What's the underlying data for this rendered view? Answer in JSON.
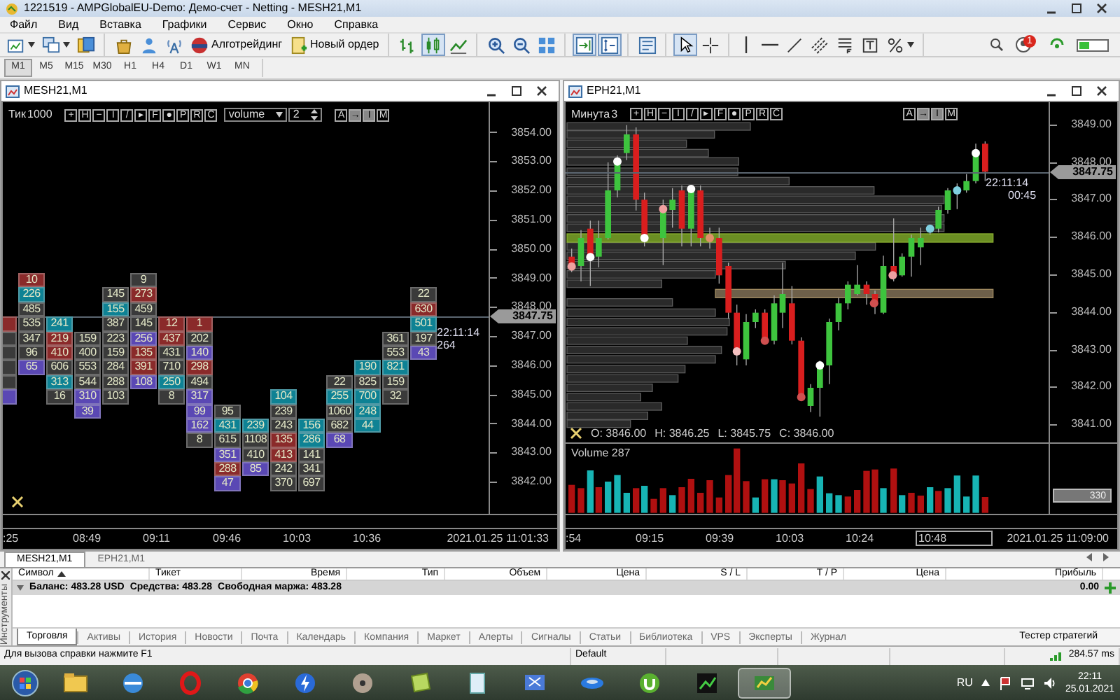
{
  "window": {
    "title": "1221519 - AMPGlobalEU-Demo: Демо-счет - Netting - MESH21,M1"
  },
  "menu": [
    "Файл",
    "Вид",
    "Вставка",
    "Графики",
    "Сервис",
    "Окно",
    "Справка"
  ],
  "toolbar": [
    [
      {
        "kind": "new-chart",
        "pressed": false,
        "menu": true
      },
      {
        "kind": "profiles",
        "pressed": false,
        "menu": true
      },
      {
        "kind": "windows",
        "pressed": false,
        "menu": false
      }
    ],
    [
      {
        "kind": "market",
        "pressed": false,
        "menu": false
      },
      {
        "kind": "navigator",
        "pressed": false,
        "menu": false
      },
      {
        "kind": "signal",
        "pressed": false,
        "menu": false
      },
      {
        "kind": "algo",
        "label": "Алготрейдинг",
        "pressed": false,
        "menu": false
      },
      {
        "kind": "order",
        "label": "Новый ордер",
        "pressed": false,
        "menu": false
      }
    ],
    [
      {
        "kind": "bars",
        "pressed": false,
        "menu": false
      },
      {
        "kind": "candles",
        "pressed": true,
        "menu": false
      },
      {
        "kind": "line",
        "pressed": false,
        "menu": false
      }
    ],
    [
      {
        "kind": "zoom-in",
        "pressed": false,
        "menu": false
      },
      {
        "kind": "zoom-out",
        "pressed": false,
        "menu": false
      },
      {
        "kind": "tile",
        "pressed": false,
        "menu": false
      }
    ],
    [
      {
        "kind": "shift",
        "pressed": true,
        "menu": false
      },
      {
        "kind": "autoscroll",
        "pressed": true,
        "menu": false
      }
    ],
    [
      {
        "kind": "template",
        "pressed": false,
        "menu": false
      }
    ],
    [
      {
        "kind": "cursor",
        "pressed": true,
        "menu": false
      },
      {
        "kind": "crosshair",
        "pressed": false,
        "menu": false
      }
    ],
    [
      {
        "kind": "vline",
        "pressed": false,
        "menu": false
      },
      {
        "kind": "hline",
        "pressed": false,
        "menu": false
      },
      {
        "kind": "trend",
        "pressed": false,
        "menu": false
      },
      {
        "kind": "channel",
        "pressed": false,
        "menu": false
      },
      {
        "kind": "levels",
        "pressed": false,
        "menu": false
      },
      {
        "kind": "textbox",
        "pressed": false,
        "menu": false
      },
      {
        "kind": "shapes",
        "pressed": false,
        "menu": true
      }
    ]
  ],
  "status_icons": {
    "notifications": "1"
  },
  "timeframes": [
    {
      "label": "M1",
      "selected": true
    },
    {
      "label": "M5",
      "selected": false
    },
    {
      "label": "M15",
      "selected": false
    },
    {
      "label": "M30",
      "selected": false
    },
    {
      "label": "H1",
      "selected": false
    },
    {
      "label": "H4",
      "selected": false
    },
    {
      "label": "D1",
      "selected": false
    },
    {
      "label": "W1",
      "selected": false
    },
    {
      "label": "MN",
      "selected": false
    }
  ],
  "charts": [
    {
      "title": "MESH21,M1",
      "kind": "footprint",
      "mode": "Тик",
      "period": "1000",
      "buttons": [
        "+",
        "H",
        "−",
        "I",
        "/",
        "▸",
        "F",
        "●",
        "P",
        "R",
        "C"
      ],
      "select": "volume",
      "spin": "2",
      "right_buttons": [
        {
          "label": "A",
          "pressed": false
        },
        {
          "label": "→",
          "pressed": true
        },
        {
          "label": "I",
          "pressed": true
        },
        {
          "label": "M",
          "pressed": false
        }
      ],
      "axis": [
        "3854.00",
        "3853.00",
        "3852.00",
        "3851.00",
        "3850.00",
        "3849.00",
        "3848.00",
        "3847.00",
        "3846.00",
        "3845.00",
        "3844.00",
        "3843.00",
        "3842.00"
      ],
      "price": "3847.75",
      "timer": "22:11:14",
      "timer_2": "264",
      "clusters": [
        {
          "cells": [
            null,
            null,
            null,
            {
              "color": "#8a2a2a"
            },
            {
              "color": "#3a3a3a"
            },
            {
              "color": "#3a3a3a"
            },
            {
              "color": "#3a3a3a"
            },
            {
              "color": "#3a3a3a"
            },
            {
              "color": "#5a48b4"
            }
          ]
        },
        {
          "cells": [
            {
              "value": "10",
              "color": "#8a2a2a"
            },
            {
              "value": "226",
              "color": "#0e8294"
            },
            {
              "value": "485",
              "color": "#3a3a3a"
            },
            {
              "value": "535",
              "color": "#3a3a3a"
            },
            {
              "value": "347",
              "color": "#3a3a3a"
            },
            {
              "value": "96",
              "color": "#3a3a3a"
            },
            {
              "value": "65",
              "color": "#5a48b4"
            }
          ]
        },
        {
          "cells": [
            null,
            null,
            null,
            {
              "value": "241",
              "color": "#0e8294"
            },
            {
              "value": "219",
              "color": "#8a2a2a"
            },
            {
              "value": "410",
              "color": "#8a2a2a"
            },
            {
              "value": "606",
              "color": "#3a3a3a"
            },
            {
              "value": "313",
              "color": "#0e8294"
            },
            {
              "value": "16",
              "color": "#3a3a3a"
            }
          ]
        },
        {
          "cells": [
            null,
            null,
            null,
            null,
            {
              "value": "159",
              "color": "#3a3a3a"
            },
            {
              "value": "400",
              "color": "#3a3a3a"
            },
            {
              "value": "553",
              "color": "#3a3a3a"
            },
            {
              "value": "544",
              "color": "#3a3a3a"
            },
            {
              "value": "310",
              "color": "#5a48b4"
            },
            {
              "value": "39",
              "color": "#5a48b4"
            }
          ]
        },
        {
          "cells": [
            null,
            {
              "value": "145",
              "color": "#3a3a3a"
            },
            {
              "value": "155",
              "color": "#0e8294"
            },
            {
              "value": "387",
              "color": "#3a3a3a"
            },
            {
              "value": "223",
              "color": "#3a3a3a"
            },
            {
              "value": "159",
              "color": "#3a3a3a"
            },
            {
              "value": "284",
              "color": "#3a3a3a"
            },
            {
              "value": "288",
              "color": "#3a3a3a"
            },
            {
              "value": "103",
              "color": "#3a3a3a"
            }
          ]
        },
        {
          "cells": [
            {
              "value": "9",
              "color": "#3a3a3a"
            },
            {
              "value": "273",
              "color": "#8a2a2a"
            },
            {
              "value": "459",
              "color": "#3a3a3a"
            },
            {
              "value": "145",
              "color": "#3a3a3a"
            },
            {
              "value": "256",
              "color": "#5a48b4"
            },
            {
              "value": "135",
              "color": "#8a2a2a"
            },
            {
              "value": "391",
              "color": "#8a2a2a"
            },
            {
              "value": "108",
              "color": "#5a48b4"
            }
          ]
        },
        {
          "cells": [
            null,
            null,
            null,
            {
              "value": "12",
              "color": "#8a2a2a"
            },
            {
              "value": "437",
              "color": "#8a2a2a"
            },
            {
              "value": "431",
              "color": "#3a3a3a"
            },
            {
              "value": "710",
              "color": "#3a3a3a"
            },
            {
              "value": "250",
              "color": "#0e8294"
            },
            {
              "value": "8",
              "color": "#3a3a3a"
            }
          ]
        },
        {
          "cells": [
            null,
            null,
            null,
            {
              "value": "1",
              "color": "#8a2a2a"
            },
            {
              "value": "202",
              "color": "#3a3a3a"
            },
            {
              "value": "140",
              "color": "#5a48b4"
            },
            {
              "value": "298",
              "color": "#8a2a2a"
            },
            {
              "value": "494",
              "color": "#3a3a3a"
            },
            {
              "value": "317",
              "color": "#5a48b4"
            },
            {
              "value": "99",
              "color": "#5a48b4"
            },
            {
              "value": "162",
              "color": "#5a48b4"
            },
            {
              "value": "8",
              "color": "#3a3a3a"
            }
          ]
        },
        {
          "cells": [
            null,
            null,
            null,
            null,
            null,
            null,
            null,
            null,
            null,
            {
              "value": "95",
              "color": "#3a3a3a"
            },
            {
              "value": "431",
              "color": "#0e8294"
            },
            {
              "value": "615",
              "color": "#3a3a3a"
            },
            {
              "value": "351",
              "color": "#5a48b4"
            },
            {
              "value": "288",
              "color": "#8a2a2a"
            },
            {
              "value": "47",
              "color": "#5a48b4"
            }
          ]
        },
        {
          "cells": [
            null,
            null,
            null,
            null,
            null,
            null,
            null,
            null,
            null,
            null,
            {
              "value": "239",
              "color": "#0e8294"
            },
            {
              "value": "1108",
              "color": "#3a3a3a"
            },
            {
              "value": "410",
              "color": "#3a3a3a"
            },
            {
              "value": "85",
              "color": "#5a48b4"
            }
          ]
        },
        {
          "cells": [
            null,
            null,
            null,
            null,
            null,
            null,
            null,
            null,
            {
              "value": "104",
              "color": "#0e8294"
            },
            {
              "value": "239",
              "color": "#3a3a3a"
            },
            {
              "value": "243",
              "color": "#3a3a3a"
            },
            {
              "value": "135",
              "color": "#8a2a2a"
            },
            {
              "value": "413",
              "color": "#8a2a2a"
            },
            {
              "value": "242",
              "color": "#3a3a3a"
            },
            {
              "value": "370",
              "color": "#3a3a3a"
            }
          ]
        },
        {
          "cells": [
            null,
            null,
            null,
            null,
            null,
            null,
            null,
            null,
            null,
            null,
            {
              "value": "156",
              "color": "#0e8294"
            },
            {
              "value": "286",
              "color": "#0e8294"
            },
            {
              "value": "141",
              "color": "#3a3a3a"
            },
            {
              "value": "341",
              "color": "#3a3a3a"
            },
            {
              "value": "697",
              "color": "#3a3a3a"
            }
          ]
        },
        {
          "cells": [
            null,
            null,
            null,
            null,
            null,
            null,
            null,
            {
              "value": "22",
              "color": "#3a3a3a"
            },
            {
              "value": "255",
              "color": "#0e8294"
            },
            {
              "value": "1060",
              "color": "#3a3a3a"
            },
            {
              "value": "682",
              "color": "#3a3a3a"
            },
            {
              "value": "68",
              "color": "#5a48b4"
            }
          ]
        },
        {
          "cells": [
            null,
            null,
            null,
            null,
            null,
            null,
            {
              "value": "190",
              "color": "#0e8294"
            },
            {
              "value": "825",
              "color": "#3a3a3a"
            },
            {
              "value": "700",
              "color": "#0e8294"
            },
            {
              "value": "248",
              "color": "#0e8294"
            },
            {
              "value": "44",
              "color": "#0e8294"
            }
          ]
        },
        {
          "cells": [
            null,
            null,
            null,
            null,
            {
              "value": "361",
              "color": "#3a3a3a"
            },
            {
              "value": "553",
              "color": "#3a3a3a"
            },
            {
              "value": "821",
              "color": "#0e8294"
            },
            {
              "value": "159",
              "color": "#3a3a3a"
            },
            {
              "value": "32",
              "color": "#3a3a3a"
            }
          ]
        },
        {
          "cells": [
            null,
            {
              "value": "22",
              "color": "#3a3a3a"
            },
            {
              "value": "630",
              "color": "#8a2a2a"
            },
            {
              "value": "501",
              "color": "#0e8294"
            },
            {
              "value": "197",
              "color": "#3a3a3a"
            },
            {
              "value": "43",
              "color": "#5a48b4"
            }
          ]
        }
      ],
      "times": [
        {
          "label": ":25",
          "boxed": false
        },
        {
          "label": "08:49",
          "boxed": false
        },
        {
          "label": "09:11",
          "boxed": false
        },
        {
          "label": "09:46",
          "boxed": false
        },
        {
          "label": "10:03",
          "boxed": false
        },
        {
          "label": "10:36",
          "boxed": false
        }
      ],
      "datetime": "2021.01.25 11:01:33"
    },
    {
      "title": "EPH21,M1",
      "kind": "candles",
      "mode": "Минута",
      "period": "3",
      "buttons": [
        "+",
        "H",
        "−",
        "I",
        "/",
        "▸",
        "F",
        "●",
        "P",
        "R",
        "C"
      ],
      "right_buttons": [
        {
          "label": "A",
          "pressed": false
        },
        {
          "label": "→",
          "pressed": true
        },
        {
          "label": "I",
          "pressed": true
        },
        {
          "label": "M",
          "pressed": false
        }
      ],
      "axis": [
        "3849.00",
        "3848.00",
        "3847.00",
        "3846.00",
        "3845.00",
        "3844.00",
        "3843.00",
        "3842.00",
        "3841.00"
      ],
      "price": "3847.75",
      "timer": "22:11:14",
      "timer_2": "00:45",
      "ohlc": [
        "O: 3846.00",
        "H: 3846.25",
        "L: 3845.75",
        "C: 3846.00"
      ],
      "volume_label": "Volume 287",
      "volume_axis": "330",
      "times": [
        {
          "label": ":54",
          "boxed": false
        },
        {
          "label": "09:15",
          "boxed": false
        },
        {
          "label": "09:39",
          "boxed": false
        },
        {
          "label": "10:03",
          "boxed": false
        },
        {
          "label": "10:24",
          "boxed": false
        },
        {
          "label": "10:48",
          "boxed": true
        }
      ],
      "datetime": "2021.01.25 11:09:00"
    }
  ],
  "chart_tabs": [
    {
      "label": "MESH21,M1",
      "selected": true
    },
    {
      "label": "EPH21,M1",
      "selected": false
    }
  ],
  "toolbox": {
    "side_label": "Инструменты",
    "columns": [
      {
        "label": "Символ",
        "sorted": true
      },
      {
        "label": "Тикет",
        "sorted": false
      },
      {
        "label": "Время",
        "sorted": false
      },
      {
        "label": "Тип",
        "sorted": false
      },
      {
        "label": "Объем",
        "sorted": false
      },
      {
        "label": "Цена",
        "sorted": false
      },
      {
        "label": "S / L",
        "sorted": false
      },
      {
        "label": "T / P",
        "sorted": false
      },
      {
        "label": "Цена",
        "sorted": false
      },
      {
        "label": "Прибыль",
        "sorted": false
      }
    ],
    "balance": [
      "Баланс: 483.28 USD",
      "Средства: 483.28",
      "Свободная маржа: 483.28"
    ],
    "profit": "0.00",
    "tabs": [
      {
        "label": "Торговля",
        "selected": true
      },
      {
        "label": "Активы",
        "selected": false
      },
      {
        "label": "История",
        "selected": false
      },
      {
        "label": "Новости",
        "selected": false
      },
      {
        "label": "Почта",
        "selected": false
      },
      {
        "label": "Календарь",
        "selected": false
      },
      {
        "label": "Компания",
        "selected": false
      },
      {
        "label": "Маркет",
        "selected": false
      },
      {
        "label": "Алерты",
        "selected": false
      },
      {
        "label": "Сигналы",
        "selected": false
      },
      {
        "label": "Статьи",
        "selected": false
      },
      {
        "label": "Библиотека",
        "selected": false
      },
      {
        "label": "VPS",
        "selected": false
      },
      {
        "label": "Эксперты",
        "selected": false
      },
      {
        "label": "Журнал",
        "selected": false
      }
    ],
    "tester": "Тестер стратегий"
  },
  "status_bar": {
    "help": "Для вызова справки нажмите F1",
    "profile": "Default",
    "ping": "284.57 ms"
  },
  "taskbar": {
    "apps": [
      {
        "kind": "folder",
        "selected": false
      },
      {
        "kind": "globe",
        "selected": false
      },
      {
        "kind": "ring",
        "selected": false
      },
      {
        "kind": "pinwheel",
        "selected": false
      },
      {
        "kind": "lightning",
        "selected": false
      },
      {
        "kind": "disc",
        "selected": false
      },
      {
        "kind": "note",
        "selected": false
      },
      {
        "kind": "notepad",
        "selected": false
      },
      {
        "kind": "scissors",
        "selected": false
      },
      {
        "kind": "disk",
        "selected": false
      },
      {
        "kind": "circle",
        "selected": false
      },
      {
        "kind": "terminal",
        "selected": false
      },
      {
        "kind": "chart-app",
        "selected": true
      }
    ],
    "language": "RU",
    "time": "22:11",
    "date": "25.01.2021"
  }
}
